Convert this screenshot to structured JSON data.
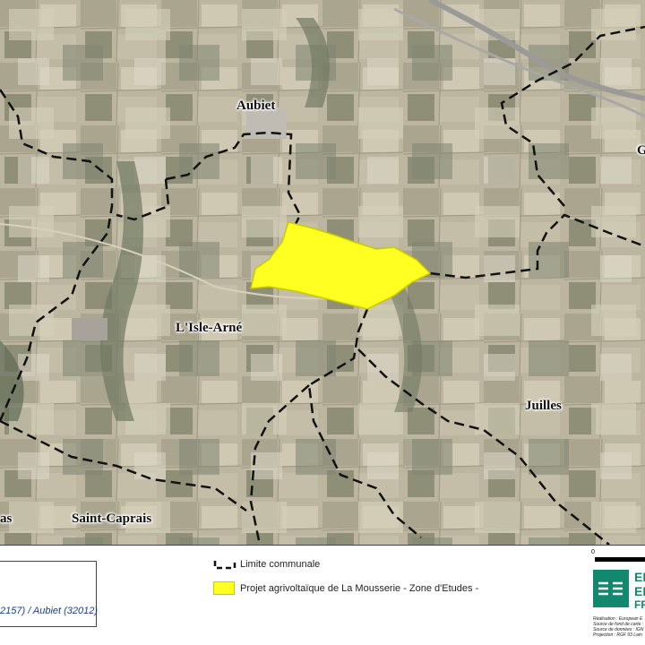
{
  "map": {
    "towns": {
      "aubiet": "Aubiet",
      "gimont_partial": "G",
      "isle_arne": "L'Isle-Arné",
      "juilles": "Juilles",
      "saint_caprais": "Saint-Caprais",
      "partial_left": "as"
    },
    "colors": {
      "boundary": "#111111",
      "zone_fill": "#ffff22",
      "zone_stroke": "#c9c900",
      "aerial_base": "#b9b39d"
    }
  },
  "legend": {
    "subtitle": "2157) / Aubiet (32012)",
    "items": [
      {
        "label": "Limite communale",
        "symbol": "dashed-line"
      },
      {
        "label": "Projet agrivoltaïque de La Mousserie - Zone d'Etudes -",
        "symbol": "yellow-fill"
      }
    ]
  },
  "scale": {
    "zero": "0"
  },
  "logo": {
    "line1": "EI",
    "line2": "EI",
    "line3": "FR",
    "icon": "logo-lines-icon"
  },
  "credits": [
    "Réalisation : European E",
    "Source de fond de carte :",
    "Source de données : IGN",
    "Projection : RGF 93 Lam"
  ]
}
